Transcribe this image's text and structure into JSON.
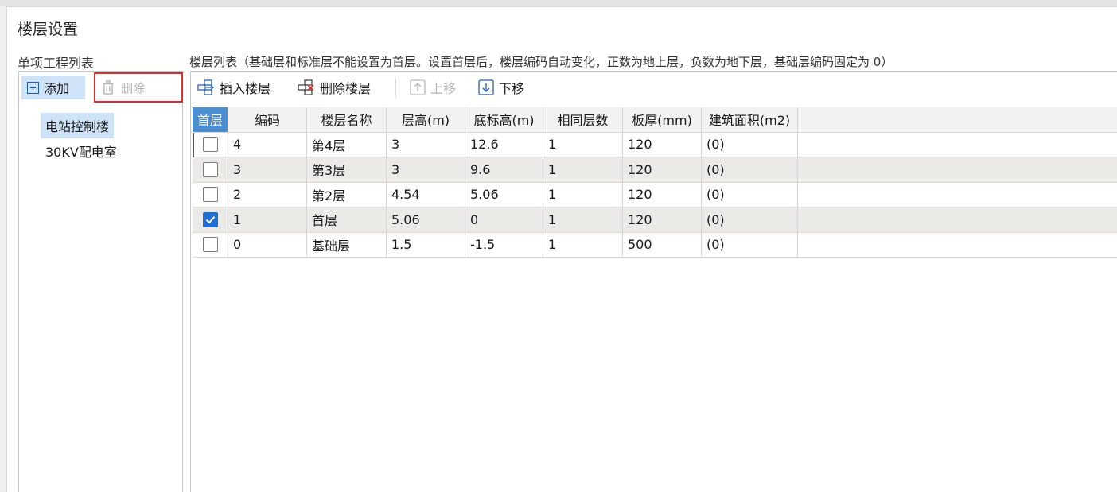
{
  "dialog": {
    "title": "楼层设置"
  },
  "left": {
    "label": "单项工程列表",
    "add_label": "添加",
    "delete_label": "删除",
    "items": [
      {
        "label": "电站控制楼",
        "selected": true
      },
      {
        "label": "30KV配电室",
        "selected": false
      }
    ]
  },
  "right": {
    "label": "楼层列表（基础层和标准层不能设置为首层。设置首层后，楼层编码自动变化，正数为地上层，负数为地下层，基础层编码固定为 0）",
    "toolbar": {
      "insert": "插入楼层",
      "delete": "删除楼层",
      "up": "上移",
      "down": "下移"
    }
  },
  "table": {
    "columns": [
      "首层",
      "编码",
      "楼层名称",
      "层高(m)",
      "底标高(m)",
      "相同层数",
      "板厚(mm)",
      "建筑面积(m2)"
    ],
    "rows": [
      {
        "first": false,
        "code": "4",
        "name": "第4层",
        "height": "3",
        "bottom": "12.6",
        "same": "1",
        "thick": "120",
        "area": "(0)"
      },
      {
        "first": false,
        "code": "3",
        "name": "第3层",
        "height": "3",
        "bottom": "9.6",
        "same": "1",
        "thick": "120",
        "area": "(0)"
      },
      {
        "first": false,
        "code": "2",
        "name": "第2层",
        "height": "4.54",
        "bottom": "5.06",
        "same": "1",
        "thick": "120",
        "area": "(0)"
      },
      {
        "first": true,
        "code": "1",
        "name": "首层",
        "height": "5.06",
        "bottom": "0",
        "same": "1",
        "thick": "120",
        "area": "(0)"
      },
      {
        "first": false,
        "code": "0",
        "name": "基础层",
        "height": "1.5",
        "bottom": "-1.5",
        "same": "1",
        "thick": "500",
        "area": "(0)"
      }
    ]
  },
  "colors": {
    "accent": "#4d8ed0",
    "selection": "#cfe3f8",
    "highlight_border": "#e42a2a",
    "check": "#1f6fd1"
  }
}
